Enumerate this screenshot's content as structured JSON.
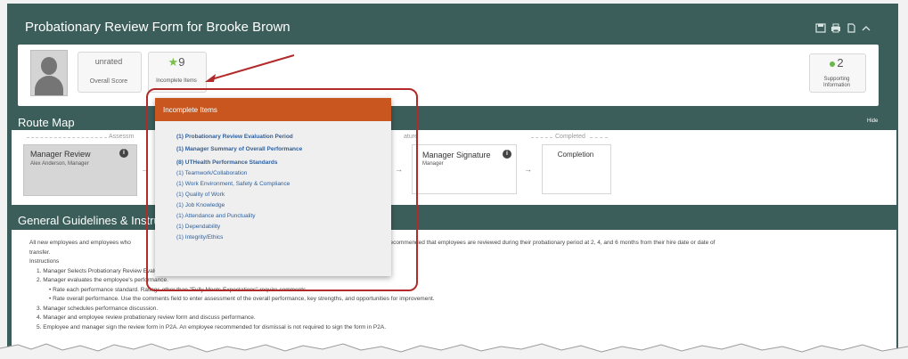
{
  "window": {
    "title": "Probationary Review Form for Brooke Brown",
    "icons": [
      "save-icon",
      "print-icon",
      "document-icon",
      "collapse-icon"
    ]
  },
  "header": {
    "score_value": "unrated",
    "score_label": "Overall Score",
    "incomplete_count": "9",
    "incomplete_label": "Incomplete Items",
    "support_count": "2",
    "support_label_line1": "Supporting",
    "support_label_line2": "Information"
  },
  "route_map": {
    "title": "Route Map",
    "hide_label": "Hide",
    "assessment_label": "Assessm",
    "signature_label": "ature",
    "completed_label": "Completed",
    "steps": [
      {
        "title": "Manager Review",
        "subtitle": "Alex Anderson, Manager"
      },
      {
        "title": "Manager Signature",
        "subtitle": "Manager"
      },
      {
        "title": "Completion",
        "subtitle": ""
      }
    ]
  },
  "popup": {
    "title": "Incomplete Items",
    "items": [
      {
        "count": "(1)",
        "label": "Probationary Review Evaluation Period",
        "bold": true
      },
      {
        "count": "(1)",
        "label": "Manager Summary of Overall Performance",
        "bold": true
      },
      {
        "count": "(8)",
        "label": "UTHealth Performance Standards",
        "bold": true
      },
      {
        "count": "(1)",
        "label": "Teamwork/Collaboration",
        "bold": false
      },
      {
        "count": "(1)",
        "label": "Work Environment, Safety & Compliance",
        "bold": false
      },
      {
        "count": "(1)",
        "label": "Quality of Work",
        "bold": false
      },
      {
        "count": "(1)",
        "label": "Job Knowledge",
        "bold": false
      },
      {
        "count": "(1)",
        "label": "Attendance and Punctuality",
        "bold": false
      },
      {
        "count": "(1)",
        "label": "Dependability",
        "bold": false
      },
      {
        "count": "(1)",
        "label": "Integrity/Ethics",
        "bold": false
      }
    ]
  },
  "guidelines": {
    "title": "General Guidelines & Instru",
    "intro_part1": "All new employees and employees who",
    "intro_part2": "ationary period. It is recommended that employees are reviewed during their probationary period at 2, 4, and 6 months from their hire date or date of",
    "intro_line2": "transfer.",
    "instructions_label": "Instructions",
    "step1": "1.  Manager Selects Probationary Review Evaluation Period.",
    "step2": "2.  Manager evaluates the employee's performance.",
    "bullet1": "•  Rate each performance standard. Ratings other than \"Fully Meets Expectations\" require comments.",
    "bullet2": "•  Rate overall performance. Use the comments field to enter assessment of the overall performance, key strengths, and opportunities for improvement.",
    "step3": "3.  Manager schedules performance discussion.",
    "step4": "4.  Manager and employee review probationary review form and discuss performance.",
    "step5": "5.  Employee and manager sign the review form in P2A. An employee recommended for dismissal is not required to sign the form in P2A."
  },
  "colors": {
    "frame": "#3b5e5a",
    "popup_header": "#c8561e",
    "annotation": "#b22a2a",
    "link": "#2e5f9b"
  }
}
